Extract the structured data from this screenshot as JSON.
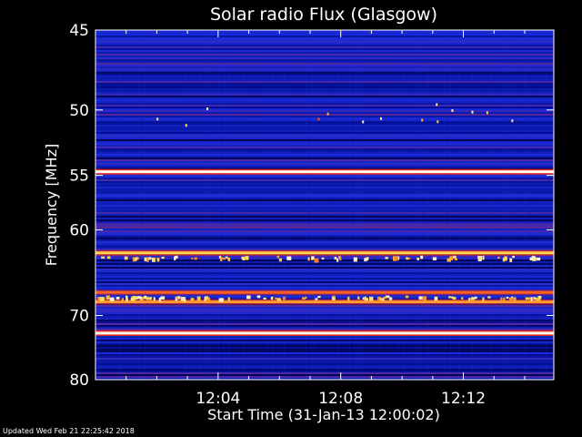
{
  "chart_data": {
    "type": "heatmap",
    "title": "Solar radio Flux (Glasgow)",
    "xlabel": "Start Time (31-Jan-13 12:00:02)",
    "ylabel": "Frequency [MHz]",
    "x_ticks": [
      "12:04",
      "12:08",
      "12:12"
    ],
    "x_tick_minutes": [
      4,
      8,
      12
    ],
    "xlim_minutes": [
      0,
      14.95
    ],
    "y_ticks": [
      45,
      50,
      55,
      60,
      70,
      80
    ],
    "ylim": [
      45,
      80
    ],
    "y_scale": "reciprocal",
    "colormap": [
      "#00002a",
      "#000a88",
      "#1a2bd8",
      "#b02040",
      "#ff2a10",
      "#ffd23a",
      "#fffbe0"
    ],
    "background": "#000000",
    "bright_bands_mhz": [
      {
        "freq": 54.7,
        "intensity": 1.0
      },
      {
        "freq": 62.4,
        "intensity": 0.85
      },
      {
        "freq": 67.0,
        "intensity": 0.72
      },
      {
        "freq": 68.2,
        "intensity": 0.78
      },
      {
        "freq": 72.5,
        "intensity": 1.0
      }
    ],
    "grid": false
  },
  "footer": "Updated Wed Feb 21 22:25:42 2018"
}
